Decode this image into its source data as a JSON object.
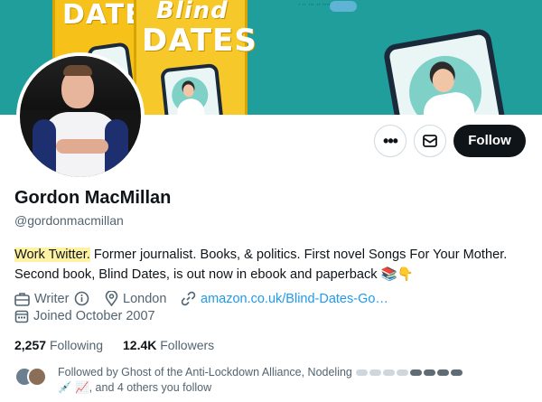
{
  "banner": {
    "book1_title": "DATE",
    "book2_title_top": "Blind",
    "book2_title_bottom": "DATES",
    "top_strip_text": "∙ ∙∙ ∙∙∙ ∙∙ ∙∙∙∙ ∙∙",
    "accent": "#1f9e9b"
  },
  "actions": {
    "more_label": "•••",
    "message_icon": "envelope-icon",
    "follow_label": "Follow"
  },
  "profile": {
    "name": "Gordon MacMillan",
    "handle": "@gordonmacmillan",
    "bio_highlight": "Work Twitter.",
    "bio_rest": " Former journalist. Books, & politics. First novel Songs For Your Mother. Second book, Blind Dates, is out now in ebook and paperback 📚👇",
    "profession": "Writer",
    "location": "London",
    "website": "amazon.co.uk/Blind-Dates-Go…",
    "joined": "Joined October 2007"
  },
  "stats": {
    "following_count": "2,257",
    "following_label": "Following",
    "followers_count": "12.4K",
    "followers_label": "Followers"
  },
  "followed_by": {
    "text": "Followed by Ghost of the Anti-Lockdown Alliance, Nodeling",
    "text_end": "💉 📈, and 4 others you follow"
  }
}
